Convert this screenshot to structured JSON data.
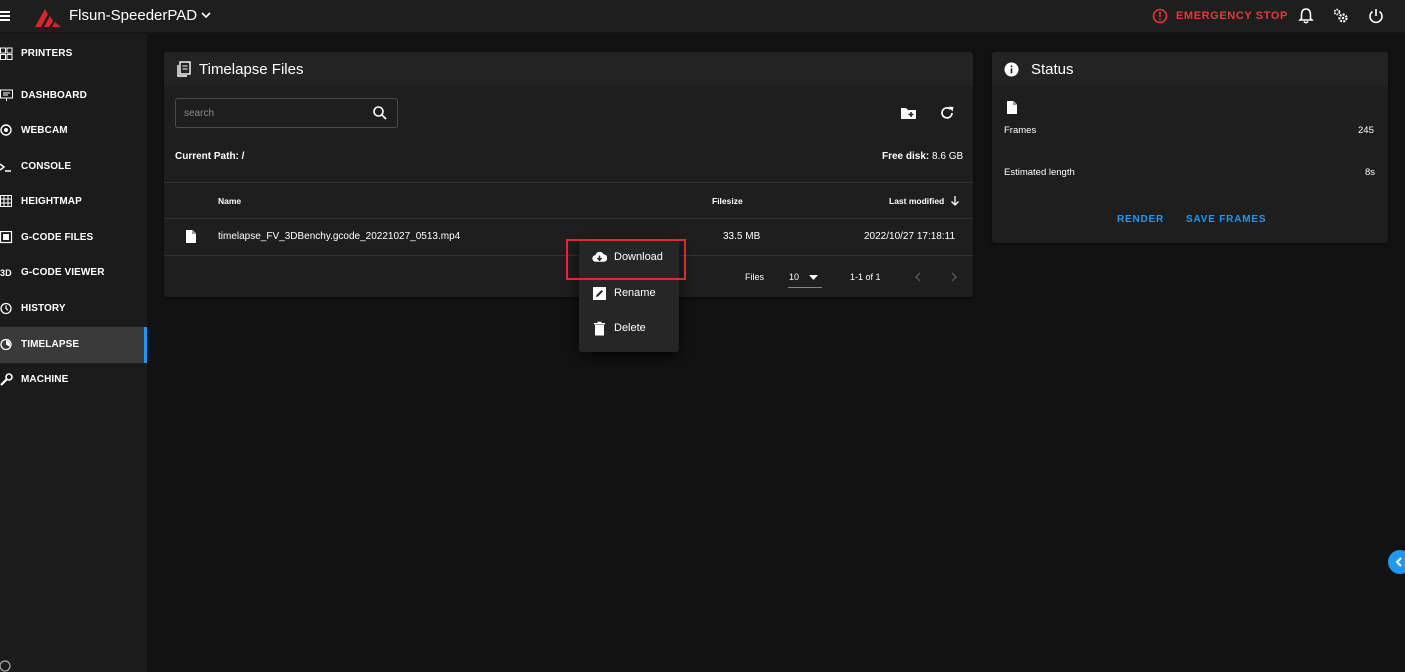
{
  "app": {
    "title": "Flsun-SpeederPAD",
    "emergency_stop_label": "EMERGENCY STOP",
    "accent_color": "#2196f3",
    "danger_color": "#e5393d"
  },
  "sidebar": {
    "items": [
      {
        "label": "PRINTERS",
        "icon": "printers-icon"
      },
      {
        "label": "DASHBOARD",
        "icon": "dashboard-icon"
      },
      {
        "label": "WEBCAM",
        "icon": "webcam-icon"
      },
      {
        "label": "CONSOLE",
        "icon": "console-icon"
      },
      {
        "label": "HEIGHTMAP",
        "icon": "heightmap-icon"
      },
      {
        "label": "G-CODE FILES",
        "icon": "gcode-files-icon"
      },
      {
        "label": "G-CODE VIEWER",
        "icon": "gcode-viewer-icon"
      },
      {
        "label": "HISTORY",
        "icon": "history-icon"
      },
      {
        "label": "TIMELAPSE",
        "icon": "timelapse-icon",
        "active": true
      },
      {
        "label": "MACHINE",
        "icon": "machine-icon"
      }
    ]
  },
  "timelapse_card": {
    "title": "Timelapse Files",
    "search_placeholder": "search",
    "current_path_label": "Current Path: /",
    "free_disk_label": "Free disk:",
    "free_disk_value": "8.6 GB",
    "columns": {
      "name": "Name",
      "filesize": "Filesize",
      "last_modified": "Last modified"
    },
    "files": [
      {
        "name": "timelapse_FV_3DBenchy.gcode_20221027_0513.mp4",
        "filesize": "33.5 MB",
        "modified": "2022/10/27 17:18:11"
      }
    ],
    "pagination": {
      "files_label": "Files",
      "per_page": "10",
      "range": "1-1 of 1"
    }
  },
  "context_menu": {
    "items": [
      {
        "label": "Download",
        "icon": "cloud-download-icon"
      },
      {
        "label": "Rename",
        "icon": "rename-icon"
      },
      {
        "label": "Delete",
        "icon": "trash-icon"
      }
    ]
  },
  "status_card": {
    "title": "Status",
    "frames_label": "Frames",
    "frames_value": "245",
    "estimated_length_label": "Estimated length",
    "estimated_length_value": "8s",
    "render_button": "RENDER",
    "save_frames_button": "SAVE FRAMES"
  }
}
